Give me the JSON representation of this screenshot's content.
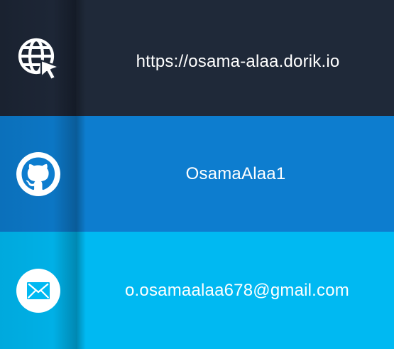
{
  "contacts": [
    {
      "type": "website",
      "icon": "globe-cursor-icon",
      "text": "https://osama-alaa.dorik.io",
      "background": "#1f2939"
    },
    {
      "type": "github",
      "icon": "github-icon",
      "text": "OsamaAlaa1",
      "background": "#0d7dcf"
    },
    {
      "type": "email",
      "icon": "envelope-icon",
      "text": "o.osamaalaa678@gmail.com",
      "background": "#00b9f2"
    }
  ]
}
